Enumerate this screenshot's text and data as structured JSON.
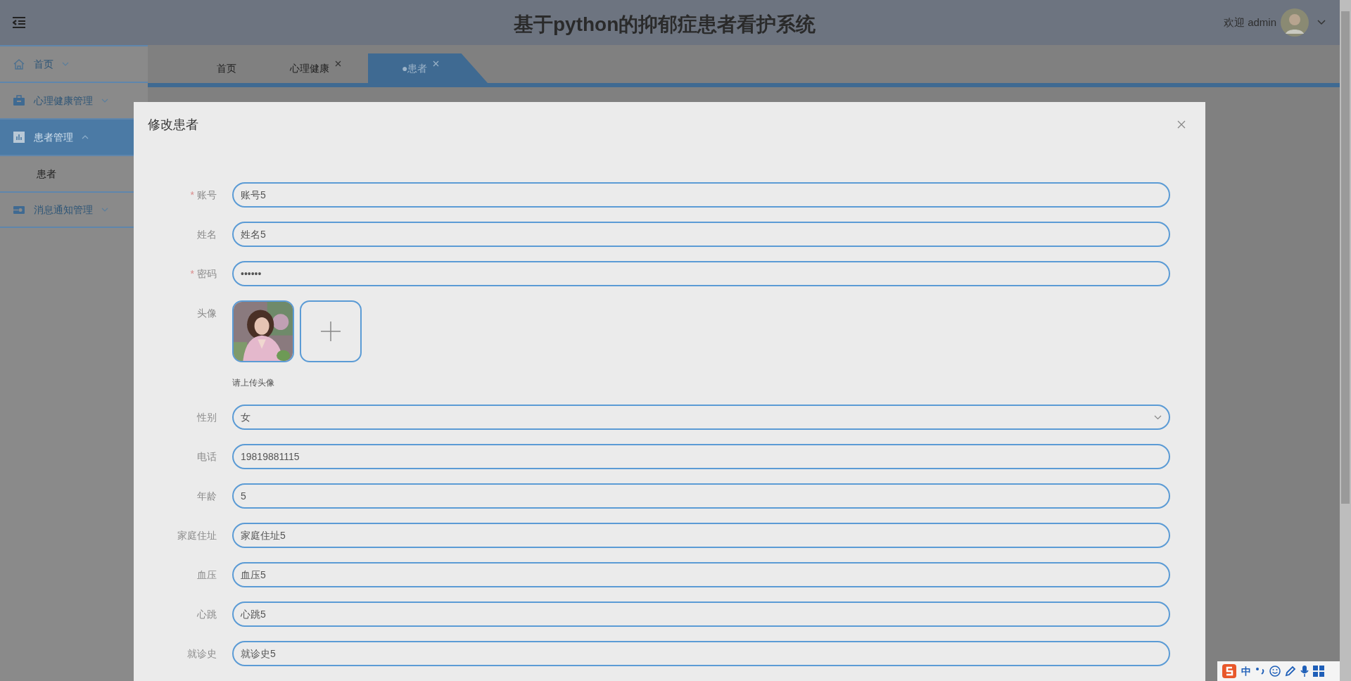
{
  "header": {
    "title": "基于python的抑郁症患者看护系统",
    "welcome": "欢迎 admin"
  },
  "sidebar": {
    "items": [
      {
        "label": "首页",
        "expanded": false,
        "selected": false
      },
      {
        "label": "心理健康管理",
        "expanded": false,
        "selected": false
      },
      {
        "label": "患者管理",
        "expanded": true,
        "selected": true,
        "children": [
          {
            "label": "患者",
            "selected": false
          }
        ]
      },
      {
        "label": "消息通知管理",
        "expanded": false,
        "selected": false
      }
    ]
  },
  "tabs": [
    {
      "label": "首页",
      "closable": false,
      "selected": false
    },
    {
      "label": "心理健康",
      "closable": true,
      "selected": false
    },
    {
      "label": "●患者",
      "closable": true,
      "selected": true
    }
  ],
  "dialog": {
    "title": "修改患者",
    "fields": [
      {
        "label": "账号",
        "required_mark": "*",
        "kind": "text",
        "value": "账号5"
      },
      {
        "label": "姓名",
        "kind": "text",
        "value": "姓名5"
      },
      {
        "label": "密码",
        "required_mark": "*",
        "kind": "text",
        "value": "••••••"
      },
      {
        "label": "头像",
        "kind": "upload",
        "hint": "请上传头像"
      },
      {
        "label": "性别",
        "kind": "select",
        "value": "女"
      },
      {
        "label": "电话",
        "kind": "text",
        "value": "19819881115"
      },
      {
        "label": "年龄",
        "kind": "text",
        "value": "5"
      },
      {
        "label": "家庭住址",
        "kind": "text",
        "value": "家庭住址5"
      },
      {
        "label": "血压",
        "kind": "text",
        "value": "血压5"
      },
      {
        "label": "心跳",
        "kind": "text",
        "value": "心跳5"
      },
      {
        "label": "就诊史",
        "kind": "text",
        "value": "就诊史5"
      }
    ]
  },
  "ime": {
    "mode": "中"
  }
}
